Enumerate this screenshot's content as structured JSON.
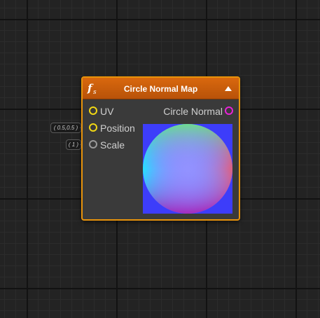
{
  "node": {
    "title": "Circle Normal Map",
    "header_color": "#c85d0a",
    "border_color": "#e8930b",
    "icon": "function-icon",
    "inputs": [
      {
        "label": "UV",
        "port_color": "#f2d814"
      },
      {
        "label": "Position",
        "port_color": "#f2d814",
        "default_value": "( 0.5,0.5 )"
      },
      {
        "label": "Scale",
        "port_color": "#9a9a9a",
        "default_value": "( 1 )"
      }
    ],
    "outputs": [
      {
        "label": "Circle Normal",
        "port_color": "#e822d8"
      }
    ],
    "preview_background": "#3d3dfa"
  }
}
